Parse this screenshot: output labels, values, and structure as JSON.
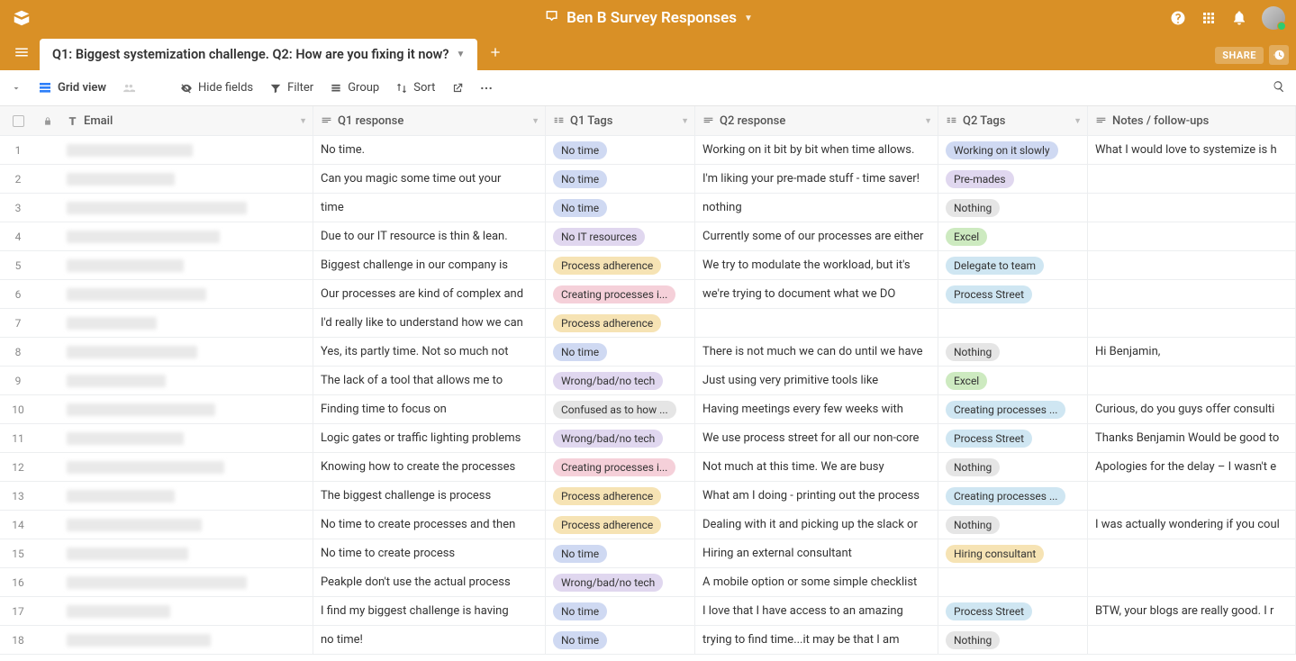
{
  "base_title": "Ben B Survey Responses",
  "tab_title": "Q1: Biggest systemization challenge. Q2: How are you fixing it now?",
  "share_label": "SHARE",
  "view": {
    "name": "Grid view"
  },
  "toolbar": {
    "hide": "Hide fields",
    "filter": "Filter",
    "group": "Group",
    "sort": "Sort"
  },
  "columns": {
    "email": "Email",
    "q1": "Q1 response",
    "q1t": "Q1 Tags",
    "q2": "Q2 response",
    "q2t": "Q2 Tags",
    "notes": "Notes / follow-ups"
  },
  "tag_colors": {
    "No time": "#cfd9f2",
    "Working on it slowly": "#cfd9f2",
    "Pre-mades": "#e0d7ef",
    "Nothing": "#e5e5e5",
    "No IT resources": "#e0d7ef",
    "Excel": "#cdeac0",
    "Process adherence": "#f6e3b4",
    "Delegate to team": "#cfe6f2",
    "Creating processes i...": "#f5d0d9",
    "Process Street": "#cfe6f2",
    "Wrong/bad/no tech": "#e0d7ef",
    "Confused as to how ...": "#e5e5e5",
    "Creating processes ...": "#cfe6f2",
    "Hiring consultant": "#f6e3b4"
  },
  "rows": [
    {
      "n": 1,
      "ew": 140,
      "q1": "No time.",
      "t1": "No time",
      "q2": "Working on it bit by bit when time allows.",
      "t2": "Working on it slowly",
      "notes": "What I would love to systemize is h"
    },
    {
      "n": 2,
      "ew": 120,
      "q1": "Can you magic some time out your",
      "t1": "No time",
      "q2": "I'm liking your pre-made stuff - time saver!",
      "t2": "Pre-mades",
      "notes": ""
    },
    {
      "n": 3,
      "ew": 200,
      "q1": "time",
      "t1": "No time",
      "q2": "nothing",
      "t2": "Nothing",
      "notes": ""
    },
    {
      "n": 4,
      "ew": 170,
      "q1": "Due to our IT resource is thin & lean.",
      "t1": "No IT resources",
      "q2": "Currently some of our processes are either",
      "t2": "Excel",
      "notes": ""
    },
    {
      "n": 5,
      "ew": 130,
      "q1": "Biggest challenge in our company is",
      "t1": "Process adherence",
      "q2": "We try to modulate the workload, but it's",
      "t2": "Delegate to team",
      "notes": ""
    },
    {
      "n": 6,
      "ew": 155,
      "q1": "Our processes are kind of complex and",
      "t1": "Creating processes i...",
      "q2": "we're trying to document what we DO",
      "t2": "Process Street",
      "notes": ""
    },
    {
      "n": 7,
      "ew": 100,
      "q1": "I'd really like to understand how we can",
      "t1": "Process adherence",
      "q2": "",
      "t2": "",
      "notes": ""
    },
    {
      "n": 8,
      "ew": 145,
      "q1": "Yes, its partly time. Not so much not",
      "t1": "No time",
      "q2": "There is not much we can do until we have",
      "t2": "Nothing",
      "notes": "Hi Benjamin,"
    },
    {
      "n": 9,
      "ew": 110,
      "q1": "The lack of a tool that allows me to",
      "t1": "Wrong/bad/no tech",
      "q2": "Just using very primitive tools like",
      "t2": "Excel",
      "notes": ""
    },
    {
      "n": 10,
      "ew": 165,
      "q1": "Finding time to focus on",
      "t1": "Confused as to how ...",
      "q2": "Having meetings every few weeks with",
      "t2": "Creating processes ...",
      "notes": "Curious, do you guys offer consulti"
    },
    {
      "n": 11,
      "ew": 130,
      "q1": "Logic gates or traffic lighting problems",
      "t1": "Wrong/bad/no tech",
      "q2": "We use process street for all our non-core",
      "t2": "Process Street",
      "notes": "Thanks Benjamin Would be good to"
    },
    {
      "n": 12,
      "ew": 175,
      "q1": "Knowing how to create the processes",
      "t1": "Creating processes i...",
      "q2": "Not much at this time. We are busy",
      "t2": "Nothing",
      "notes": "Apologies for the delay – I wasn't e"
    },
    {
      "n": 13,
      "ew": 120,
      "q1": "The biggest challenge is process",
      "t1": "Process adherence",
      "q2": "What am I doing - printing out the process",
      "t2": "Creating processes ...",
      "notes": ""
    },
    {
      "n": 14,
      "ew": 150,
      "q1": "No time to create processes and then",
      "t1": "Process adherence",
      "q2": "Dealing with it and picking up the slack or",
      "t2": "Nothing",
      "notes": "I was actually wondering if you coul"
    },
    {
      "n": 15,
      "ew": 135,
      "q1": "No time to create process",
      "t1": "No time",
      "q2": "Hiring an external consultant",
      "t2": "Hiring consultant",
      "notes": ""
    },
    {
      "n": 16,
      "ew": 200,
      "q1": "Peakple don't use the actual process",
      "t1": "Wrong/bad/no tech",
      "q2": "A mobile option or some simple checklist",
      "t2": "",
      "notes": ""
    },
    {
      "n": 17,
      "ew": 115,
      "q1": "I find my biggest challenge is having",
      "t1": "No time",
      "q2": "I love that I have access to an amazing",
      "t2": "Process Street",
      "notes": "BTW, your blogs are really good. I r"
    },
    {
      "n": 18,
      "ew": 160,
      "q1": "no time!",
      "t1": "No time",
      "q2": "trying to find time...it may be that I am",
      "t2": "Nothing",
      "notes": ""
    }
  ]
}
